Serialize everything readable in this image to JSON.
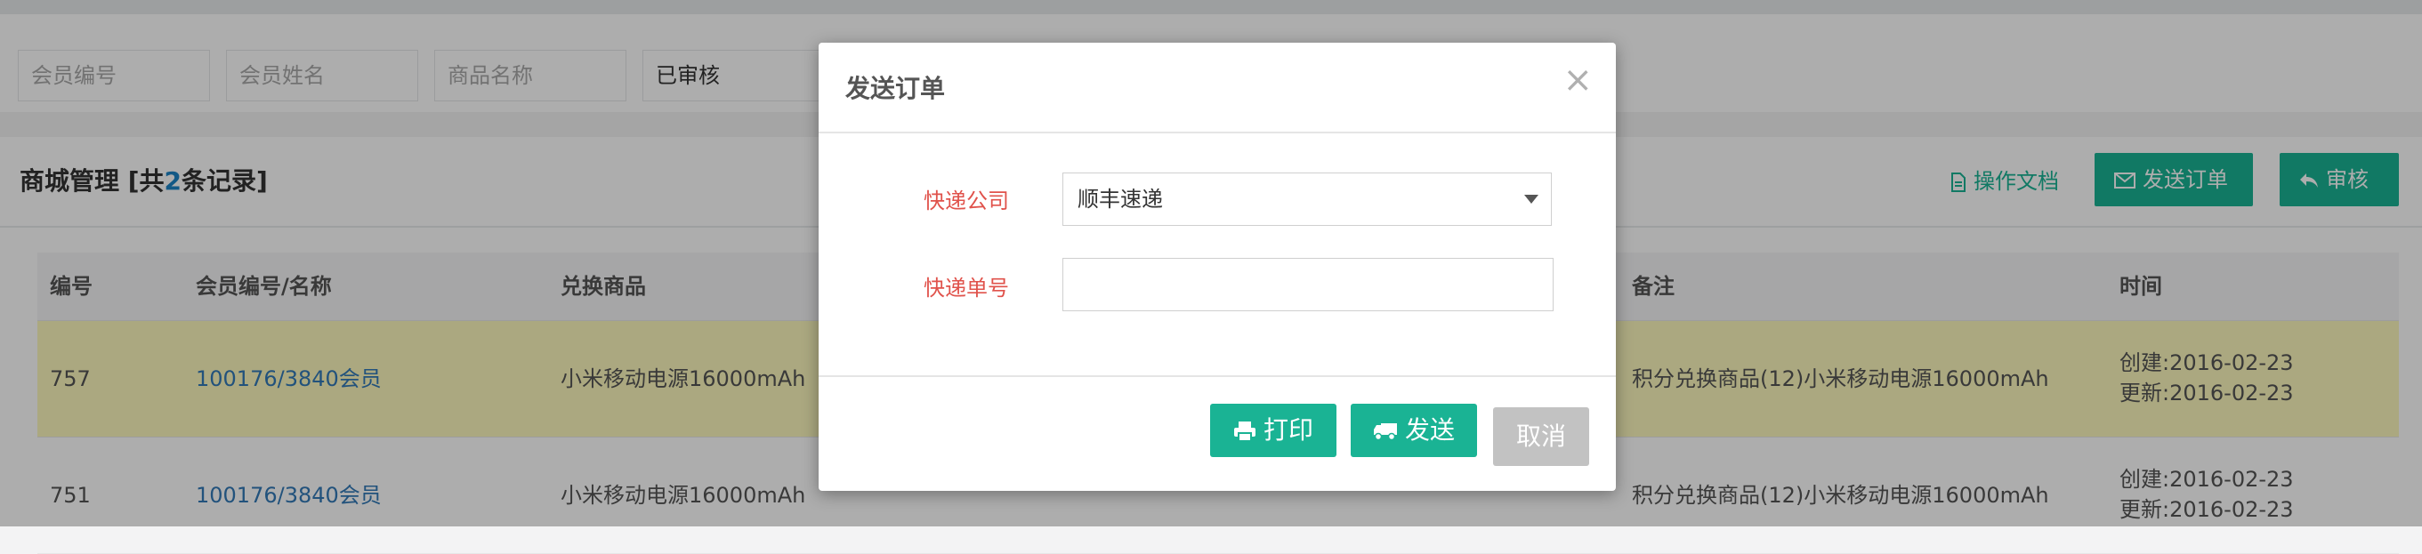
{
  "filters": {
    "member_no_placeholder": "会员编号",
    "member_name_placeholder": "会员姓名",
    "product_name_placeholder": "商品名称",
    "status_selected": "已审核"
  },
  "panel": {
    "title_prefix": "商城管理 [共",
    "count": "2",
    "title_suffix": "条记录]",
    "doc_link": "操作文档",
    "send_order_btn": "发送订单",
    "review_btn": "审核"
  },
  "table": {
    "headers": {
      "id": "编号",
      "member": "会员编号/名称",
      "product": "兑换商品",
      "remark": "备注",
      "time": "时间"
    },
    "rows": [
      {
        "id": "757",
        "member": "100176/3840会员",
        "product": "小米移动电源16000mAh",
        "remark": "积分兑换商品(12)小米移动电源16000mAh",
        "created": "创建:2016-02-23",
        "updated": "更新:2016-02-23"
      },
      {
        "id": "751",
        "member": "100176/3840会员",
        "product": "小米移动电源16000mAh",
        "remark": "积分兑换商品(12)小米移动电源16000mAh",
        "created": "创建:2016-02-23",
        "updated": "更新:2016-02-23"
      }
    ]
  },
  "modal": {
    "title": "发送订单",
    "close": "×",
    "courier_label": "快递公司",
    "courier_value": "顺丰速递",
    "tracking_label": "快递单号",
    "tracking_value": "",
    "print_btn": "打印",
    "send_btn": "发送",
    "cancel_btn": "取消"
  },
  "colors": {
    "accent": "#1ab394",
    "label_red": "#e0524b",
    "link_blue": "#337ab7",
    "highlight_row": "#fcf8bd"
  }
}
